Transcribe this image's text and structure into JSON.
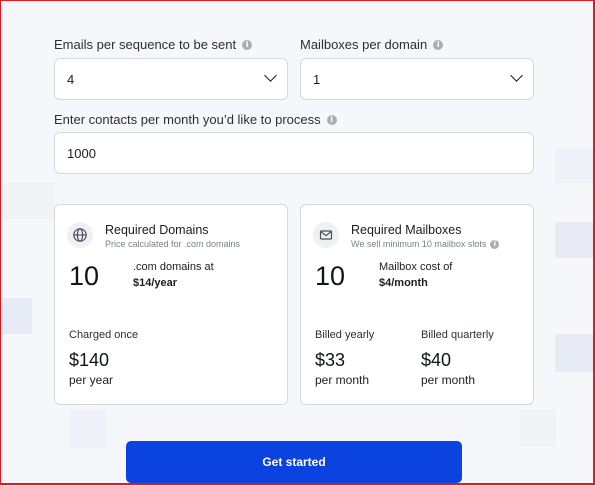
{
  "fields": {
    "emails_per_sequence": {
      "label": "Emails per sequence to be sent",
      "value": "4"
    },
    "mailboxes_per_domain": {
      "label": "Mailboxes per domain",
      "value": "1"
    },
    "contacts_per_month": {
      "label": "Enter contacts per month you’d like to process",
      "value": "1000"
    }
  },
  "domains_card": {
    "title": "Required Domains",
    "subtitle": "Price calculated for .com domains",
    "count": "10",
    "desc_line1": ".com domains at",
    "desc_line2": "$14/year",
    "charge_label": "Charged once",
    "charge_price": "$140",
    "charge_period": "per year"
  },
  "mailboxes_card": {
    "title": "Required Mailboxes",
    "subtitle": "We sell minimum 10 mailbox slots",
    "count": "10",
    "desc_line1": "Mailbox cost of",
    "desc_line2": "$4/month",
    "yearly_label": "Billed yearly",
    "yearly_price": "$33",
    "yearly_period": "per month",
    "quarterly_label": "Billed quarterly",
    "quarterly_price": "$40",
    "quarterly_period": "per month"
  },
  "cta": {
    "label": "Get started"
  },
  "colors": {
    "accent": "#0a43e0",
    "frame": "#e2181d"
  }
}
